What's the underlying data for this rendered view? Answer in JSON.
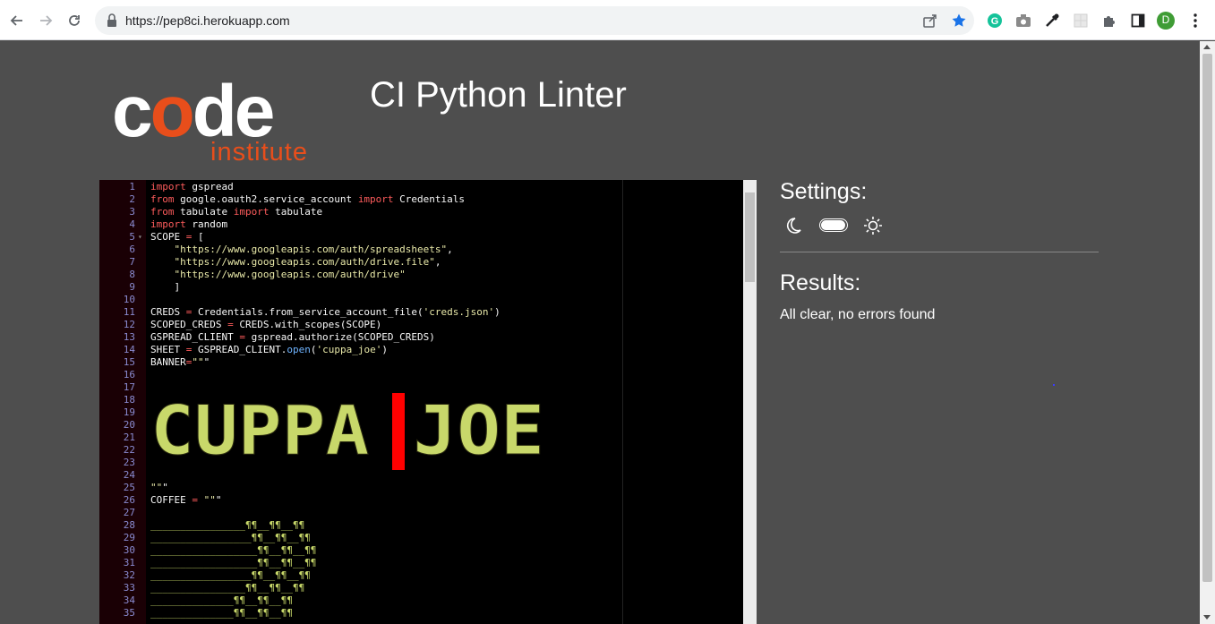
{
  "browser": {
    "url": "https://pep8ci.herokuapp.com",
    "profile_initial": "D"
  },
  "page": {
    "logo_word": "code",
    "logo_sub": "institute",
    "title": "CI Python Linter"
  },
  "editor": {
    "lines": [
      {
        "n": "1",
        "text": "import gspread"
      },
      {
        "n": "2",
        "text": "from google.oauth2.service_account import Credentials"
      },
      {
        "n": "3",
        "text": "from tabulate import tabulate"
      },
      {
        "n": "4",
        "text": "import random"
      },
      {
        "n": "5",
        "text": "SCOPE = ["
      },
      {
        "n": "6",
        "text": "    \"https://www.googleapis.com/auth/spreadsheets\","
      },
      {
        "n": "7",
        "text": "    \"https://www.googleapis.com/auth/drive.file\","
      },
      {
        "n": "8",
        "text": "    \"https://www.googleapis.com/auth/drive\""
      },
      {
        "n": "9",
        "text": "    ]"
      },
      {
        "n": "10",
        "text": ""
      },
      {
        "n": "11",
        "text": "CREDS = Credentials.from_service_account_file('creds.json')"
      },
      {
        "n": "12",
        "text": "SCOPED_CREDS = CREDS.with_scopes(SCOPE)"
      },
      {
        "n": "13",
        "text": "GSPREAD_CLIENT = gspread.authorize(SCOPED_CREDS)"
      },
      {
        "n": "14",
        "text": "SHEET = GSPREAD_CLIENT.open('cuppa_joe')"
      },
      {
        "n": "15",
        "text": "BANNER=\"\"\""
      },
      {
        "n": "16",
        "text": ""
      },
      {
        "n": "17",
        "text": ""
      },
      {
        "n": "18",
        "text": ""
      },
      {
        "n": "19",
        "text": ""
      },
      {
        "n": "20",
        "text": ""
      },
      {
        "n": "21",
        "text": ""
      },
      {
        "n": "22",
        "text": ""
      },
      {
        "n": "23",
        "text": ""
      },
      {
        "n": "24",
        "text": ""
      },
      {
        "n": "25",
        "text": "\"\"\""
      },
      {
        "n": "26",
        "text": "COFFEE = \"\"\""
      },
      {
        "n": "27",
        "text": ""
      },
      {
        "n": "28",
        "text": "________________¶¶__¶¶__¶¶"
      },
      {
        "n": "29",
        "text": "_________________¶¶__¶¶__¶¶"
      },
      {
        "n": "30",
        "text": "__________________¶¶__¶¶__¶¶"
      },
      {
        "n": "31",
        "text": "__________________¶¶__¶¶__¶¶"
      },
      {
        "n": "32",
        "text": "_________________¶¶__¶¶__¶¶"
      },
      {
        "n": "33",
        "text": "________________¶¶__¶¶__¶¶"
      },
      {
        "n": "34",
        "text": "______________¶¶__¶¶__¶¶"
      },
      {
        "n": "35",
        "text": "______________¶¶__¶¶__¶¶"
      }
    ],
    "banner_text": "CUPPA JOE"
  },
  "settings": {
    "title": "Settings:",
    "theme_dark_icon": "moon-icon",
    "theme_light_icon": "sun-icon"
  },
  "results": {
    "title": "Results:",
    "message": "All clear, no errors found"
  },
  "colors": {
    "page_bg": "#4e4e4e",
    "logo_accent": "#e84e1b",
    "keyword": "#ff5c5c",
    "banner_green": "#c8d86a",
    "banner_red": "#ff0000"
  }
}
